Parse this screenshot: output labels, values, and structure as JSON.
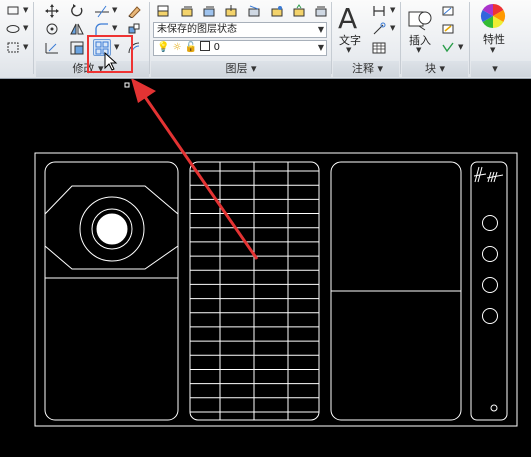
{
  "ribbon": {
    "panels": {
      "modify": {
        "title": "修改"
      },
      "layers": {
        "title": "图层",
        "layer_state": "未保存的图层状态",
        "current_layer": "0"
      },
      "annotation": {
        "title": "注释",
        "text_label": "文字"
      },
      "block": {
        "title": "块",
        "insert_label": "插入"
      },
      "properties": {
        "label": "特性"
      }
    },
    "highlighted_tool": "array-icon"
  },
  "colors": {
    "highlight": "#e33333",
    "arrow": "#e33333",
    "drawing_lines": "#ffffff",
    "canvas": "#000000"
  }
}
